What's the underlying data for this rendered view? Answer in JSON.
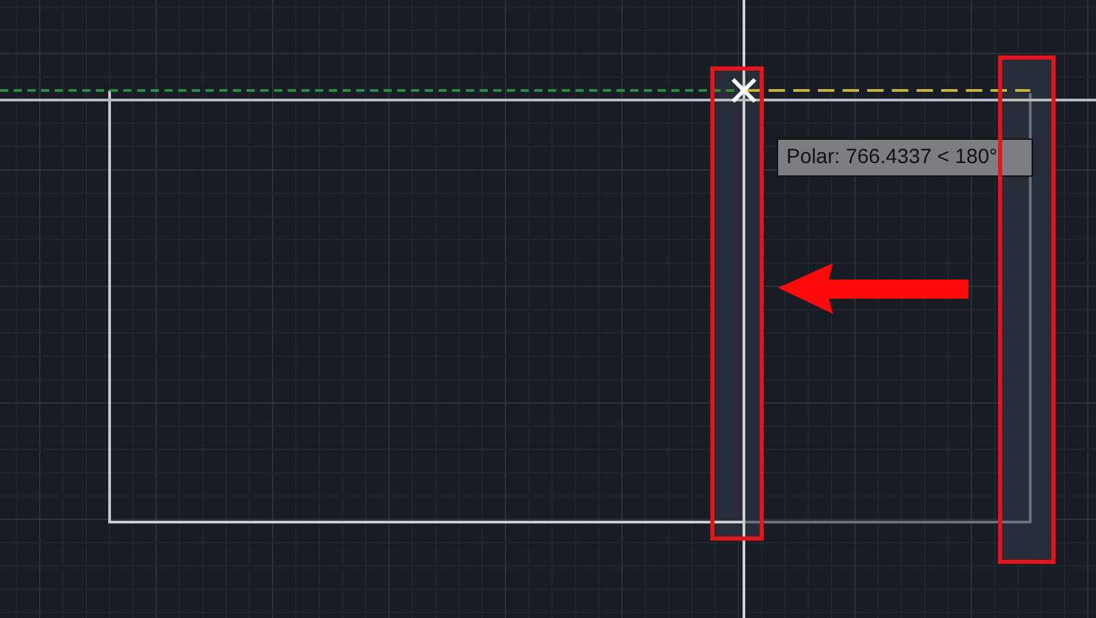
{
  "tooltip": {
    "text": "Polar: 766.4337 < 180°"
  }
}
